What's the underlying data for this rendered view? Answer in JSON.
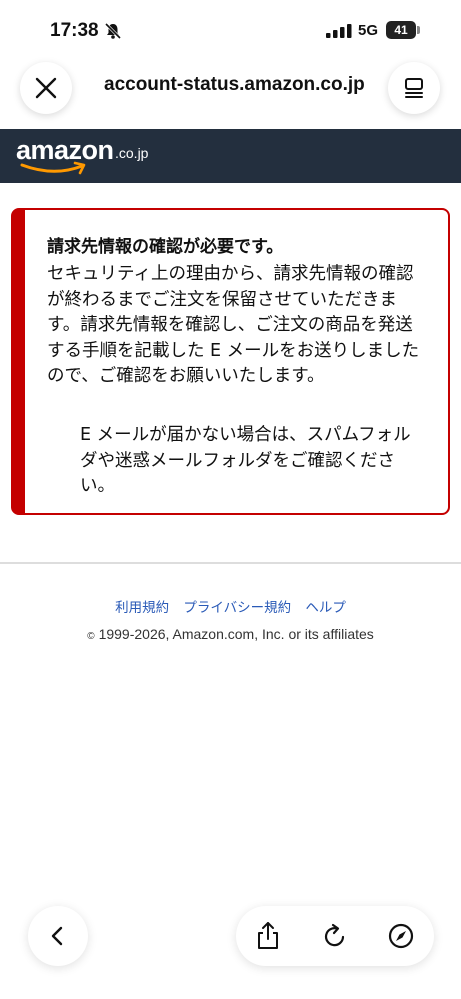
{
  "status_bar": {
    "time": "17:38",
    "network": "5G",
    "battery": "41",
    "icons": [
      "bell-slash-icon",
      "signal-bars-icon"
    ]
  },
  "browser": {
    "url": "account-status.amazon.co.jp",
    "icons": [
      "close-icon",
      "tabs-icon"
    ]
  },
  "header": {
    "logo_word": "amazon",
    "logo_suffix": ".co.jp"
  },
  "alert": {
    "heading": "請求先情報の確認が必要です。",
    "body": "セキュリティ上の理由から、請求先情報の確認が終わるまでご注文を保留させていただきます。請求先情報を確認し、ご注文の商品を発送する手順を記載した E メールをお送りしましたので、ご確認をお願いいたします。",
    "note": "E メールが届かない場合は、スパムフォルダや迷惑メールフォルダをご確認ください。",
    "accent_color": "#c40000"
  },
  "footer": {
    "links": [
      "利用規約",
      "プライバシー規約",
      "ヘルプ"
    ],
    "copyright_symbol": "©",
    "copyright": "1999-2026, Amazon.com, Inc. or its affiliates",
    "link_color": "#2a5ab7"
  },
  "bottom_bar": {
    "icons": [
      "back-chevron-icon",
      "share-icon",
      "reload-icon",
      "compass-icon"
    ]
  },
  "colors": {
    "header_bg": "#232f3e",
    "smile": "#ff9900"
  }
}
